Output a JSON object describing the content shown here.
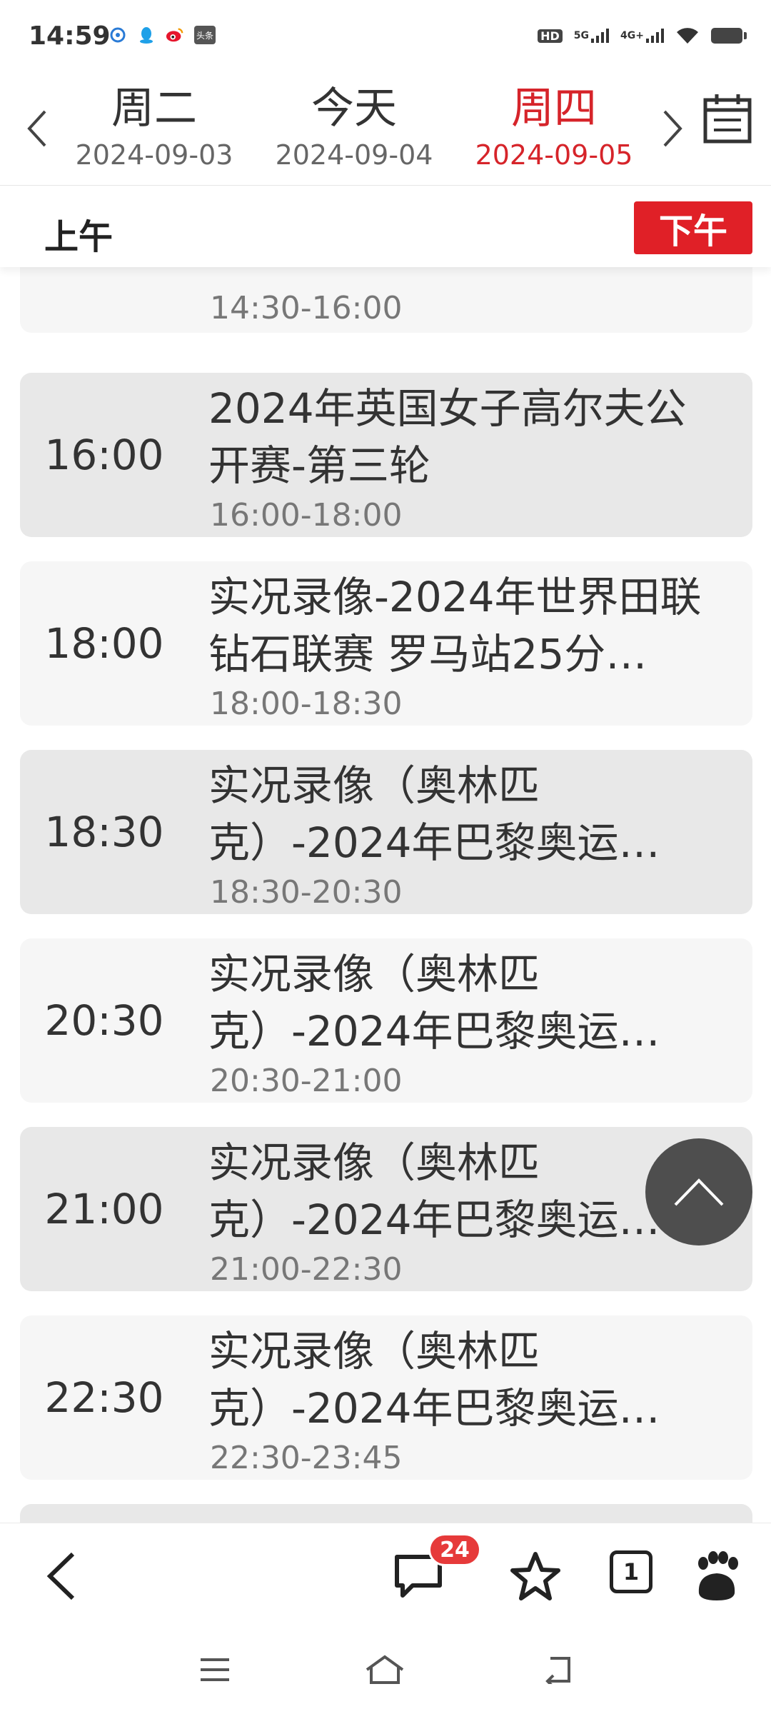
{
  "status_bar": {
    "time": "14:59",
    "notification_icons": [
      "app-icon",
      "qq-icon",
      "weibo-icon",
      "toutiao-icon"
    ],
    "toutiao_label": "头条",
    "hd_label": "HD",
    "net_5g": "5G",
    "net_4g": "4G+"
  },
  "date_nav": {
    "days": [
      {
        "name": "周二",
        "date": "2024-09-03"
      },
      {
        "name": "今天",
        "date": "2024-09-04"
      },
      {
        "name": "周四",
        "date": "2024-09-05"
      }
    ],
    "active_index": 2,
    "active_color": "#d6242a"
  },
  "period_tabs": {
    "am_label": "上午",
    "pm_label": "下午",
    "selected": "pm"
  },
  "programs": [
    {
      "time": "",
      "title": "",
      "range": "14:30-16:00"
    },
    {
      "time": "16:00",
      "title": "2024年英国女子高尔夫公开赛-第三轮",
      "range": "16:00-18:00"
    },
    {
      "time": "18:00",
      "title": "实况录像-2024年世界田联钻石联赛 罗马站25分…",
      "range": "18:00-18:30"
    },
    {
      "time": "18:30",
      "title": "实况录像（奥林匹克）-2024年巴黎奥运…",
      "range": "18:30-20:30"
    },
    {
      "time": "20:30",
      "title": "实况录像（奥林匹克）-2024年巴黎奥运…",
      "range": "20:30-21:00"
    },
    {
      "time": "21:00",
      "title": "实况录像（奥林匹克）-2024年巴黎奥运…",
      "range": "21:00-22:30"
    },
    {
      "time": "22:30",
      "title": "实况录像（奥林匹克）-2024年巴黎奥运…",
      "range": "22:30-23:45"
    }
  ],
  "bottom_bar": {
    "comment_badge": "24",
    "tab_count": "1"
  }
}
